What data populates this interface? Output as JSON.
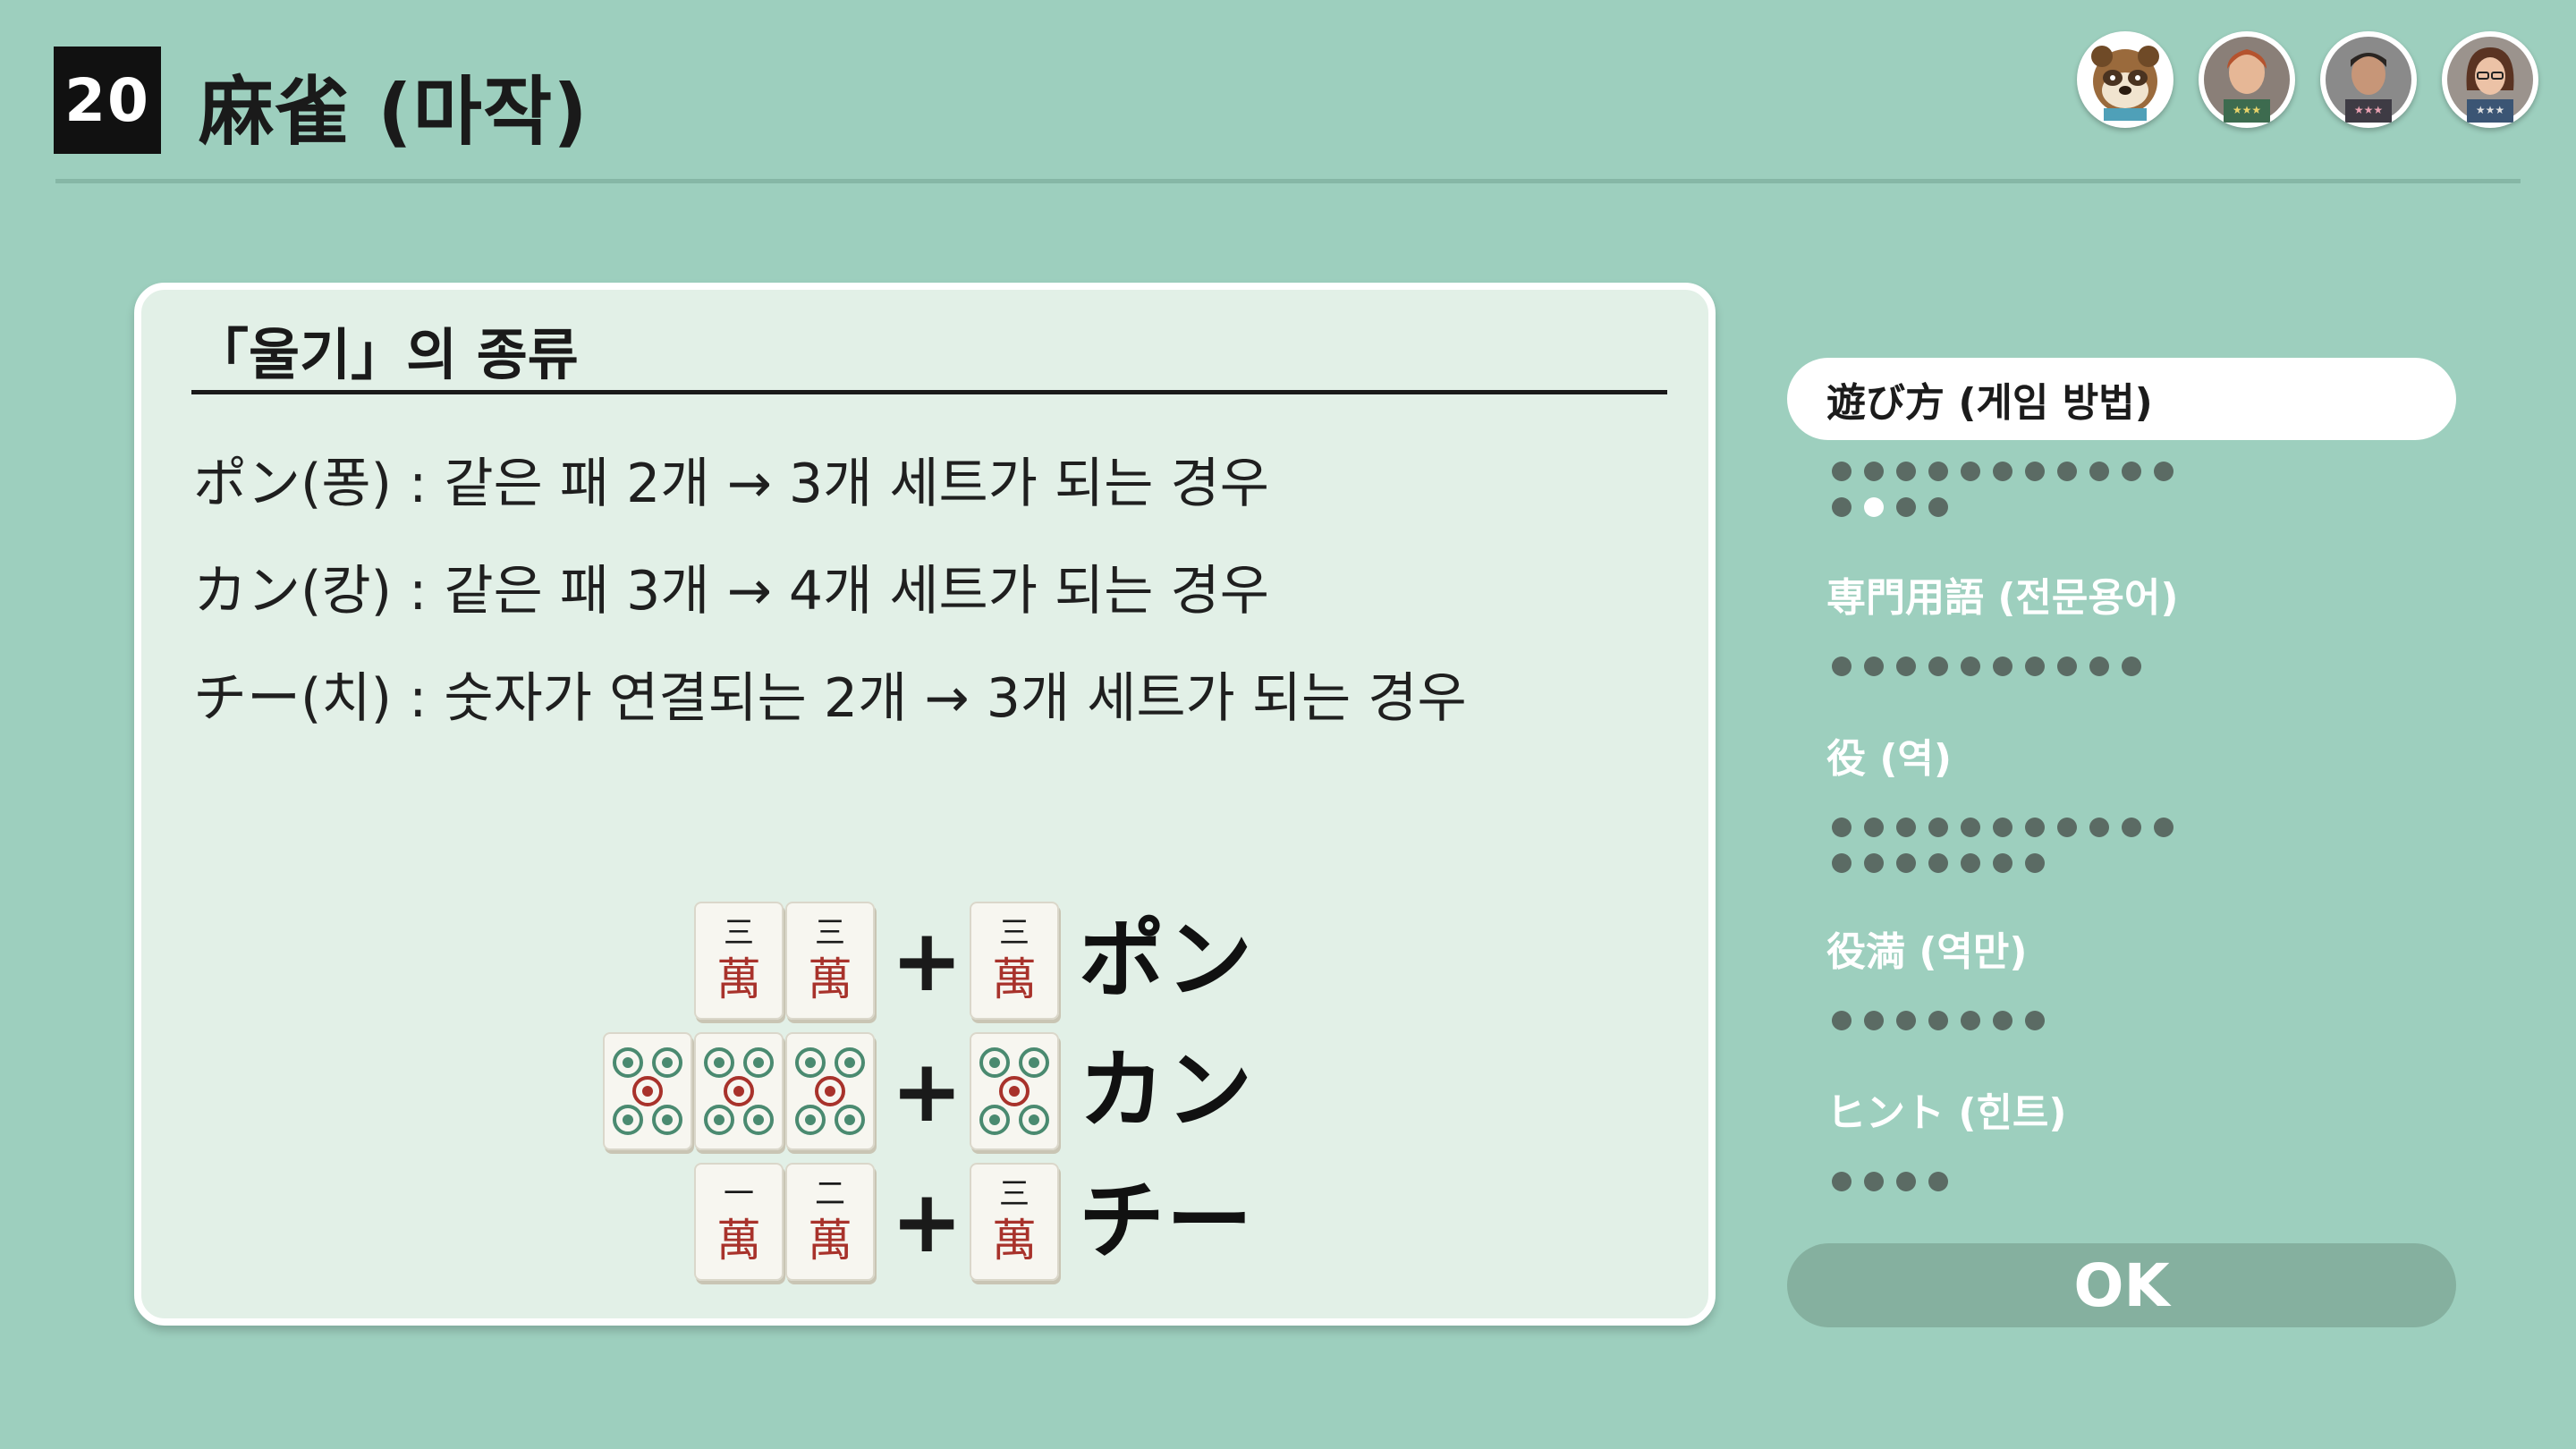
{
  "header": {
    "game_number": "20",
    "title": "麻雀 (마작)"
  },
  "players": [
    {
      "name": "raccoon-avatar"
    },
    {
      "name": "player-avatar-2"
    },
    {
      "name": "player-avatar-3"
    },
    {
      "name": "player-avatar-4"
    }
  ],
  "panel": {
    "heading": "「울기」의 종류",
    "lines": [
      "ポン(퐁) : 같은 패 2개 → 3개 세트가 되는 경우",
      "カン(캉) : 같은 패 3개 → 4개 세트가 되는 경우",
      "チー(치) : 숫자가 연결되는 2개 → 3개 세트가 되는 경우"
    ],
    "diagram": {
      "plus": "+",
      "rows": [
        {
          "label": "ポン",
          "tiles_before": [
            "三萬",
            "三萬"
          ],
          "tile_after": "三萬"
        },
        {
          "label": "カン",
          "tiles_before": [
            "五筒",
            "五筒",
            "五筒"
          ],
          "tile_after": "五筒"
        },
        {
          "label": "チー",
          "tiles_before": [
            "一萬",
            "二萬"
          ],
          "tile_after": "三萬"
        }
      ]
    }
  },
  "sidebar": {
    "items": [
      {
        "label": "遊び方 (게임 방법)",
        "active": true,
        "pages": 15,
        "current_page": 13
      },
      {
        "label": "専門用語 (전문용어)",
        "active": false,
        "pages": 10
      },
      {
        "label": "役 (역)",
        "active": false,
        "pages": 18
      },
      {
        "label": "役満 (역만)",
        "active": false,
        "pages": 7
      },
      {
        "label": "ヒント (힌트)",
        "active": false,
        "pages": 4
      }
    ],
    "ok_label": "OK"
  },
  "colors": {
    "background": "#9dcfbe",
    "panel": "#e2f0e7",
    "dot": "#5b6b64",
    "tile_red": "#a8322b",
    "tile_green": "#4a8a70"
  }
}
